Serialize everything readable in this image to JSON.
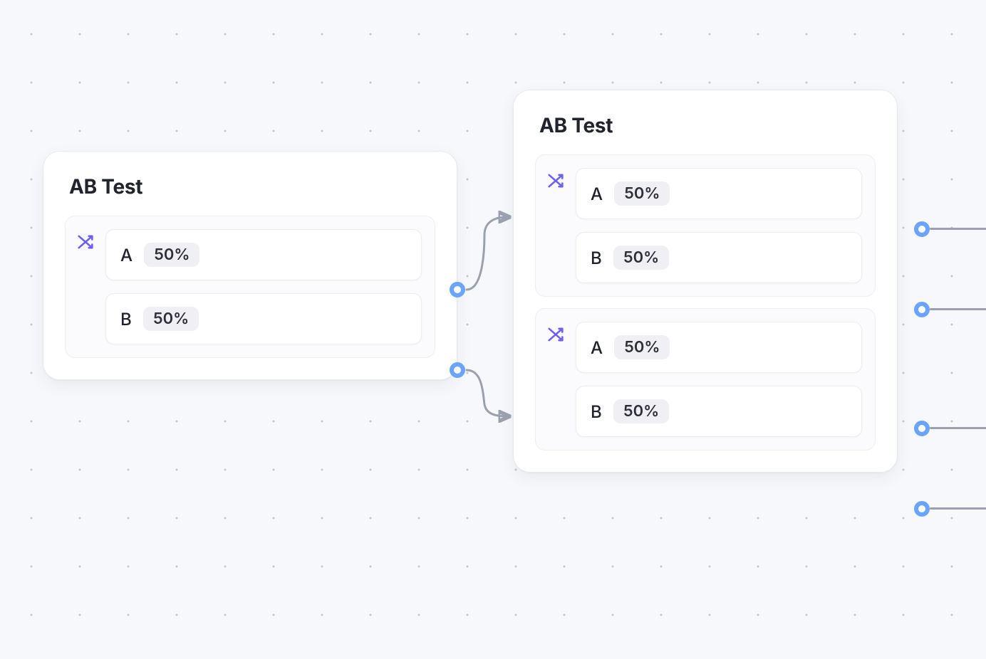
{
  "nodes": {
    "left": {
      "title": "AB Test",
      "panels": [
        {
          "rows": [
            {
              "label": "A",
              "value": "50%"
            },
            {
              "label": "B",
              "value": "50%"
            }
          ]
        }
      ]
    },
    "right": {
      "title": "AB Test",
      "panels": [
        {
          "rows": [
            {
              "label": "A",
              "value": "50%"
            },
            {
              "label": "B",
              "value": "50%"
            }
          ]
        },
        {
          "rows": [
            {
              "label": "A",
              "value": "50%"
            },
            {
              "label": "B",
              "value": "50%"
            }
          ]
        }
      ]
    }
  },
  "colors": {
    "accent": "#6d5efc",
    "port": "#6aa4ff",
    "edge": "#9aa0ae"
  }
}
